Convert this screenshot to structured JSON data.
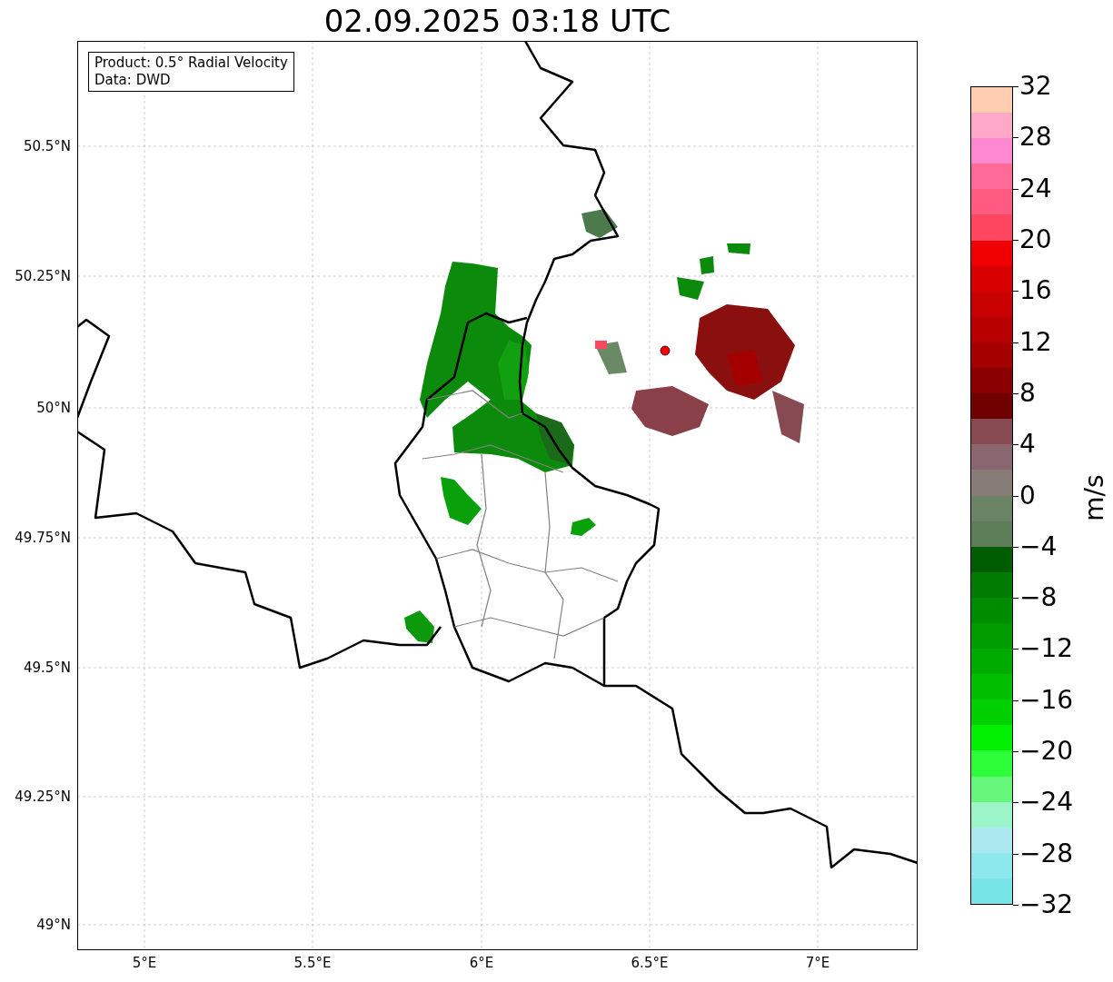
{
  "title": "02.09.2025 03:18 UTC",
  "info_box": {
    "lines": [
      "Product: 0.5° Radial Velocity",
      "Data: DWD"
    ]
  },
  "map": {
    "lat_ticks": [
      "50.5°N",
      "50.25°N",
      "50°N",
      "49.75°N",
      "49.5°N",
      "49.25°N",
      "49°N"
    ],
    "lon_ticks": [
      "5°E",
      "5.5°E",
      "6°E",
      "6.5°E",
      "7°E"
    ]
  },
  "colorbar": {
    "label": "m/s",
    "ticks": [
      "32",
      "28",
      "24",
      "20",
      "16",
      "12",
      "8",
      "4",
      "0",
      "−4",
      "−8",
      "−12",
      "−16",
      "−20",
      "−24",
      "−28",
      "−32"
    ],
    "bands": [
      {
        "color": "#ffcdb0"
      },
      {
        "color": "#ffa8c8"
      },
      {
        "color": "#ff88d0"
      },
      {
        "color": "#ff6a98"
      },
      {
        "color": "#ff5a80"
      },
      {
        "color": "#ff4660"
      },
      {
        "color": "#f00000"
      },
      {
        "color": "#d80000"
      },
      {
        "color": "#c80000"
      },
      {
        "color": "#b80000"
      },
      {
        "color": "#a40000"
      },
      {
        "color": "#8a0000"
      },
      {
        "color": "#6e0000"
      },
      {
        "color": "#884a52"
      },
      {
        "color": "#8a6670"
      },
      {
        "color": "#887c78"
      },
      {
        "color": "#6b8466"
      },
      {
        "color": "#5e7e5a"
      },
      {
        "color": "#005c00"
      },
      {
        "color": "#007b00"
      },
      {
        "color": "#008c00"
      },
      {
        "color": "#009c00"
      },
      {
        "color": "#00ab00"
      },
      {
        "color": "#00bd00"
      },
      {
        "color": "#00cf00"
      },
      {
        "color": "#00f000"
      },
      {
        "color": "#2efd3a"
      },
      {
        "color": "#66f77a"
      },
      {
        "color": "#9cf5c8"
      },
      {
        "color": "#ace8f0"
      },
      {
        "color": "#8ce8ec"
      },
      {
        "color": "#77e4e8"
      }
    ]
  }
}
